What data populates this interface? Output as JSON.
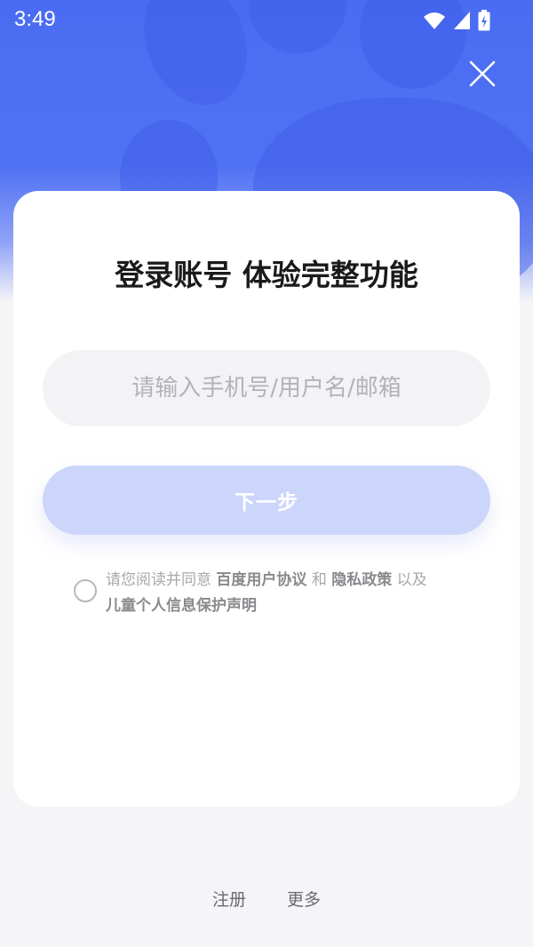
{
  "status_bar": {
    "time": "3:49",
    "icons": [
      "wifi-icon",
      "signal-icon",
      "battery-charging-icon"
    ]
  },
  "header": {
    "close_icon": "close-icon"
  },
  "login_card": {
    "title": "登录账号 体验完整功能",
    "account_input": {
      "value": "",
      "placeholder": "请输入手机号/用户名/邮箱"
    },
    "next_button_label": "下一步",
    "agreement": {
      "checked": false,
      "prefix": "请您阅读并同意",
      "link_1": "百度用户协议",
      "joiner": "和",
      "link_2": "隐私政策",
      "joiner_2": "以及",
      "link_3": "儿童个人信息保护声明"
    }
  },
  "footer": {
    "register_label": "注册",
    "more_label": "更多"
  },
  "colors": {
    "hero_blue": "#4a6cf2",
    "button_disabled": "#ccd6fb",
    "card_bg": "#ffffff",
    "page_bg": "#f5f5f7"
  }
}
